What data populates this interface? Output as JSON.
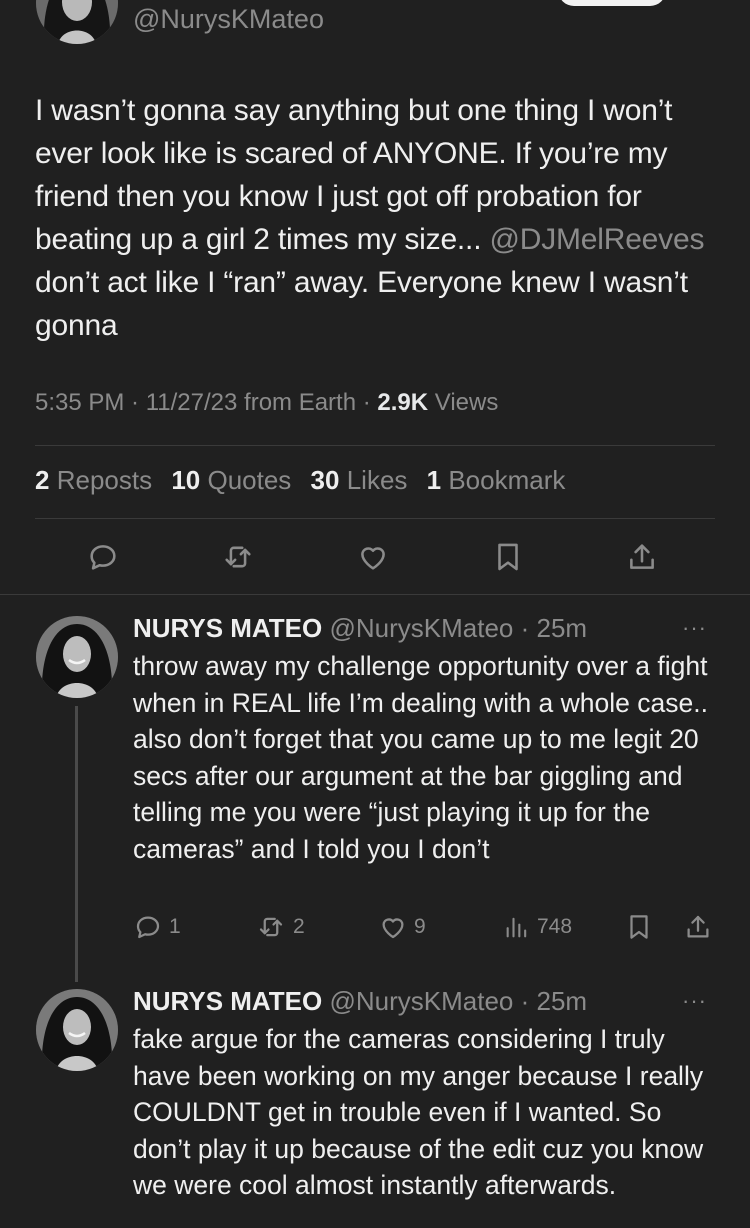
{
  "tweet": {
    "handle": "@NurysKMateo",
    "text_before_mention": "I wasn’t gonna say anything but one thing I won’t ever look like is scared of ANYONE. If you’re my friend then you know I just got off probation for beating up a girl 2 times my size... ",
    "mention": "@DJMelReeves",
    "text_after_mention": " don’t act like I “ran” away. Everyone knew I wasn’t gonna",
    "time": "5:35 PM",
    "date": "11/27/23",
    "source": "from Earth",
    "views_count": "2.9K",
    "views_label": "Views",
    "sep": " · "
  },
  "stats": {
    "reposts_count": "2",
    "reposts_label": "Reposts",
    "quotes_count": "10",
    "quotes_label": "Quotes",
    "likes_count": "30",
    "likes_label": "Likes",
    "bookmarks_count": "1",
    "bookmarks_label": "Bookmark"
  },
  "actions": [
    "reply-icon",
    "repost-icon",
    "like-icon",
    "bookmark-icon",
    "share-icon"
  ],
  "replies": [
    {
      "name": "NURYS MATEO",
      "handle": "@NurysKMateo",
      "time": "· 25m",
      "more": "···",
      "text": "throw away my challenge opportunity over a fight when in REAL life I’m dealing with a whole case.. also don’t forget that you came up to me legit 20 secs after our argument at the bar giggling and telling me you were “just playing it up for the cameras” and I told you I don’t",
      "replies": "1",
      "reposts": "2",
      "likes": "9",
      "views": "748"
    },
    {
      "name": "NURYS MATEO",
      "handle": "@NurysKMateo",
      "time": "· 25m",
      "more": "···",
      "text": "fake argue for the cameras considering I truly have been working on my anger because I really COULDNT get in trouble even if I wanted. So don’t play it up because of the edit cuz you know we were cool almost instantly afterwards."
    }
  ],
  "colors": {
    "background": "#202020",
    "text": "#efefef",
    "muted": "#8b8b8b",
    "divider": "#3a3a3a"
  }
}
